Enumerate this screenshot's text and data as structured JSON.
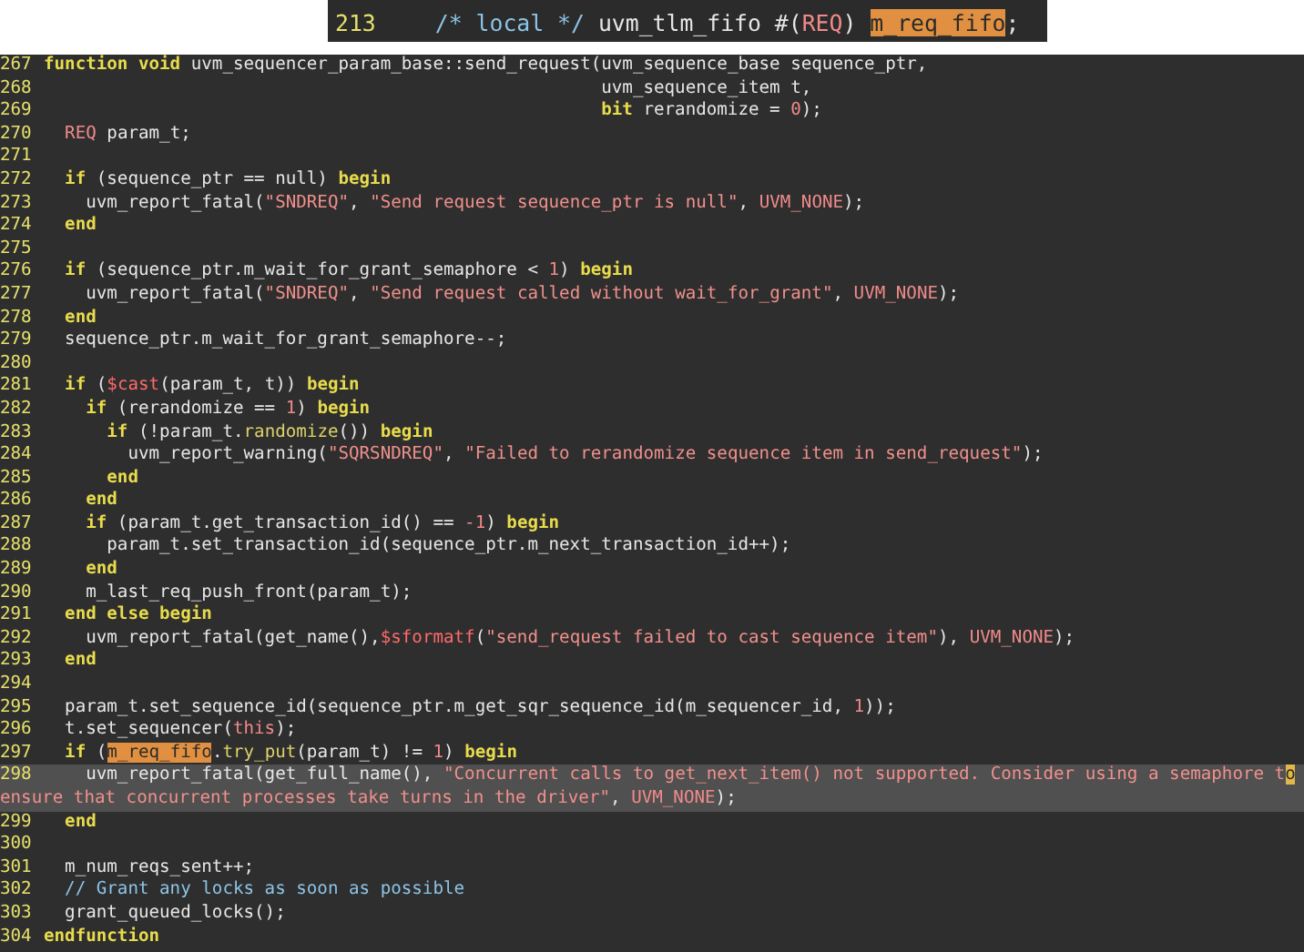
{
  "snippet": {
    "number": "213",
    "tokens": [
      {
        "text": "  /* local */",
        "kind": "comment"
      },
      {
        "text": " uvm_tlm_fifo #(",
        "kind": "plain"
      },
      {
        "text": "REQ",
        "kind": "const"
      },
      {
        "text": ") ",
        "kind": "plain"
      },
      {
        "text": "m_req_fifo",
        "kind": "match"
      },
      {
        "text": ";",
        "kind": "plain"
      }
    ]
  },
  "lines": [
    {
      "number": "267",
      "current": false,
      "tokens": [
        {
          "text": "function void",
          "kind": "kw"
        },
        {
          "text": " uvm_sequencer_param_base::send_request(uvm_sequence_base sequence_ptr,",
          "kind": "plain"
        }
      ]
    },
    {
      "number": "268",
      "current": false,
      "tokens": [
        {
          "text": "                                                     uvm_sequence_item t,",
          "kind": "plain"
        }
      ]
    },
    {
      "number": "269",
      "current": false,
      "tokens": [
        {
          "text": "                                                     bit",
          "kind": "kw"
        },
        {
          "text": " rerandomize = ",
          "kind": "plain"
        },
        {
          "text": "0",
          "kind": "const"
        },
        {
          "text": ");",
          "kind": "plain"
        }
      ]
    },
    {
      "number": "270",
      "current": false,
      "tokens": [
        {
          "text": "  REQ",
          "kind": "const"
        },
        {
          "text": " param_t;",
          "kind": "plain"
        }
      ]
    },
    {
      "number": "271",
      "current": false
    },
    {
      "number": "272",
      "current": false,
      "tokens": [
        {
          "text": "  if",
          "kind": "kw"
        },
        {
          "text": " (sequence_ptr == null) ",
          "kind": "plain"
        },
        {
          "text": "begin",
          "kind": "kw"
        }
      ]
    },
    {
      "number": "273",
      "current": false,
      "tokens": [
        {
          "text": "    uvm_report_fatal(",
          "kind": "plain"
        },
        {
          "text": "\"SNDREQ\"",
          "kind": "str"
        },
        {
          "text": ", ",
          "kind": "plain"
        },
        {
          "text": "\"Send request sequence_ptr is null\"",
          "kind": "str"
        },
        {
          "text": ", ",
          "kind": "plain"
        },
        {
          "text": "UVM_NONE",
          "kind": "const"
        },
        {
          "text": ");",
          "kind": "plain"
        }
      ]
    },
    {
      "number": "274",
      "current": false,
      "tokens": [
        {
          "text": "  end",
          "kind": "kw"
        }
      ]
    },
    {
      "number": "275",
      "current": false
    },
    {
      "number": "276",
      "current": false,
      "tokens": [
        {
          "text": "  if",
          "kind": "kw"
        },
        {
          "text": " (sequence_ptr.m_wait_for_grant_semaphore < ",
          "kind": "plain"
        },
        {
          "text": "1",
          "kind": "const"
        },
        {
          "text": ") ",
          "kind": "plain"
        },
        {
          "text": "begin",
          "kind": "kw"
        }
      ]
    },
    {
      "number": "277",
      "current": false,
      "tokens": [
        {
          "text": "    uvm_report_fatal(",
          "kind": "plain"
        },
        {
          "text": "\"SNDREQ\"",
          "kind": "str"
        },
        {
          "text": ", ",
          "kind": "plain"
        },
        {
          "text": "\"Send request called without wait_for_grant\"",
          "kind": "str"
        },
        {
          "text": ", ",
          "kind": "plain"
        },
        {
          "text": "UVM_NONE",
          "kind": "const"
        },
        {
          "text": ");",
          "kind": "plain"
        }
      ]
    },
    {
      "number": "278",
      "current": false,
      "tokens": [
        {
          "text": "  end",
          "kind": "kw"
        }
      ]
    },
    {
      "number": "279",
      "current": false,
      "tokens": [
        {
          "text": "  sequence_ptr.m_wait_for_grant_semaphore--;",
          "kind": "plain"
        }
      ]
    },
    {
      "number": "280",
      "current": false
    },
    {
      "number": "281",
      "current": false,
      "tokens": [
        {
          "text": "  if",
          "kind": "kw"
        },
        {
          "text": " (",
          "kind": "plain"
        },
        {
          "text": "$cast",
          "kind": "sys"
        },
        {
          "text": "(param_t, t)) ",
          "kind": "plain"
        },
        {
          "text": "begin",
          "kind": "kw"
        }
      ]
    },
    {
      "number": "282",
      "current": false,
      "tokens": [
        {
          "text": "    if",
          "kind": "kw"
        },
        {
          "text": " (rerandomize == ",
          "kind": "plain"
        },
        {
          "text": "1",
          "kind": "const"
        },
        {
          "text": ") ",
          "kind": "plain"
        },
        {
          "text": "begin",
          "kind": "kw"
        }
      ]
    },
    {
      "number": "283",
      "current": false,
      "tokens": [
        {
          "text": "      if",
          "kind": "kw"
        },
        {
          "text": " (!param_t.",
          "kind": "plain"
        },
        {
          "text": "randomize",
          "kind": "method"
        },
        {
          "text": "()) ",
          "kind": "plain"
        },
        {
          "text": "begin",
          "kind": "kw"
        }
      ]
    },
    {
      "number": "284",
      "current": false,
      "tokens": [
        {
          "text": "        uvm_report_warning(",
          "kind": "plain"
        },
        {
          "text": "\"SQRSNDREQ\"",
          "kind": "str"
        },
        {
          "text": ", ",
          "kind": "plain"
        },
        {
          "text": "\"Failed to rerandomize sequence item in send_request\"",
          "kind": "str"
        },
        {
          "text": ");",
          "kind": "plain"
        }
      ]
    },
    {
      "number": "285",
      "current": false,
      "tokens": [
        {
          "text": "      end",
          "kind": "kw"
        }
      ]
    },
    {
      "number": "286",
      "current": false,
      "tokens": [
        {
          "text": "    end",
          "kind": "kw"
        }
      ]
    },
    {
      "number": "287",
      "current": false,
      "tokens": [
        {
          "text": "    if",
          "kind": "kw"
        },
        {
          "text": " (param_t.get_transaction_id() == ",
          "kind": "plain"
        },
        {
          "text": "-1",
          "kind": "const"
        },
        {
          "text": ") ",
          "kind": "plain"
        },
        {
          "text": "begin",
          "kind": "kw"
        }
      ]
    },
    {
      "number": "288",
      "current": false,
      "tokens": [
        {
          "text": "      param_t.set_transaction_id(sequence_ptr.m_next_transaction_id++);",
          "kind": "plain"
        }
      ]
    },
    {
      "number": "289",
      "current": false,
      "tokens": [
        {
          "text": "    end",
          "kind": "kw"
        }
      ]
    },
    {
      "number": "290",
      "current": false,
      "tokens": [
        {
          "text": "    m_last_req_push_front(param_t);",
          "kind": "plain"
        }
      ]
    },
    {
      "number": "291",
      "current": false,
      "tokens": [
        {
          "text": "  end else begin",
          "kind": "kw"
        }
      ]
    },
    {
      "number": "292",
      "current": false,
      "tokens": [
        {
          "text": "    uvm_report_fatal(get_name(),",
          "kind": "plain"
        },
        {
          "text": "$sformatf",
          "kind": "sys"
        },
        {
          "text": "(",
          "kind": "plain"
        },
        {
          "text": "\"send_request failed to cast sequence item\"",
          "kind": "str"
        },
        {
          "text": "), ",
          "kind": "plain"
        },
        {
          "text": "UVM_NONE",
          "kind": "const"
        },
        {
          "text": ");",
          "kind": "plain"
        }
      ]
    },
    {
      "number": "293",
      "current": false,
      "tokens": [
        {
          "text": "  end",
          "kind": "kw"
        }
      ]
    },
    {
      "number": "294",
      "current": false
    },
    {
      "number": "295",
      "current": false,
      "tokens": [
        {
          "text": "  param_t.set_sequence_id(sequence_ptr.m_get_sqr_sequence_id(m_sequencer_id, ",
          "kind": "plain"
        },
        {
          "text": "1",
          "kind": "const"
        },
        {
          "text": "));",
          "kind": "plain"
        }
      ]
    },
    {
      "number": "296",
      "current": false,
      "tokens": [
        {
          "text": "  t.set_sequencer(",
          "kind": "plain"
        },
        {
          "text": "this",
          "kind": "const"
        },
        {
          "text": ");",
          "kind": "plain"
        }
      ]
    },
    {
      "number": "297",
      "current": false,
      "tokens": [
        {
          "text": "  if",
          "kind": "kw"
        },
        {
          "text": " (",
          "kind": "plain"
        },
        {
          "text": "m_req_fifo",
          "kind": "match"
        },
        {
          "text": ".",
          "kind": "plain"
        },
        {
          "text": "try_put",
          "kind": "method"
        },
        {
          "text": "(param_t) != ",
          "kind": "plain"
        },
        {
          "text": "1",
          "kind": "const"
        },
        {
          "text": ") ",
          "kind": "plain"
        },
        {
          "text": "begin",
          "kind": "kw"
        }
      ]
    },
    {
      "number": "298",
      "current": true,
      "tokens": [
        {
          "text": "    uvm_report_fatal(get_full_name(), ",
          "kind": "plain"
        },
        {
          "text": "\"Concurrent calls to get_next_item() not supported. Consider using a semaphore t",
          "kind": "str"
        },
        {
          "text": "o",
          "kind": "cursor"
        }
      ],
      "wrapped": [
        {
          "text": "ensure that concurrent processes take turns in the driver\"",
          "kind": "str"
        },
        {
          "text": ", ",
          "kind": "plain"
        },
        {
          "text": "UVM_NONE",
          "kind": "const"
        },
        {
          "text": ");",
          "kind": "plain"
        }
      ]
    },
    {
      "number": "299",
      "current": false,
      "tokens": [
        {
          "text": "  end",
          "kind": "kw"
        }
      ]
    },
    {
      "number": "300",
      "current": false
    },
    {
      "number": "301",
      "current": false,
      "tokens": [
        {
          "text": "  m_num_reqs_sent++;",
          "kind": "plain"
        }
      ]
    },
    {
      "number": "302",
      "current": false,
      "tokens": [
        {
          "text": "  // Grant any locks as soon as possible",
          "kind": "comment"
        }
      ]
    },
    {
      "number": "303",
      "current": false,
      "tokens": [
        {
          "text": "  grant_queued_locks();",
          "kind": "plain"
        }
      ]
    },
    {
      "number": "304",
      "current": false,
      "tokens": [
        {
          "text": "endfunction",
          "kind": "kw"
        }
      ]
    }
  ]
}
